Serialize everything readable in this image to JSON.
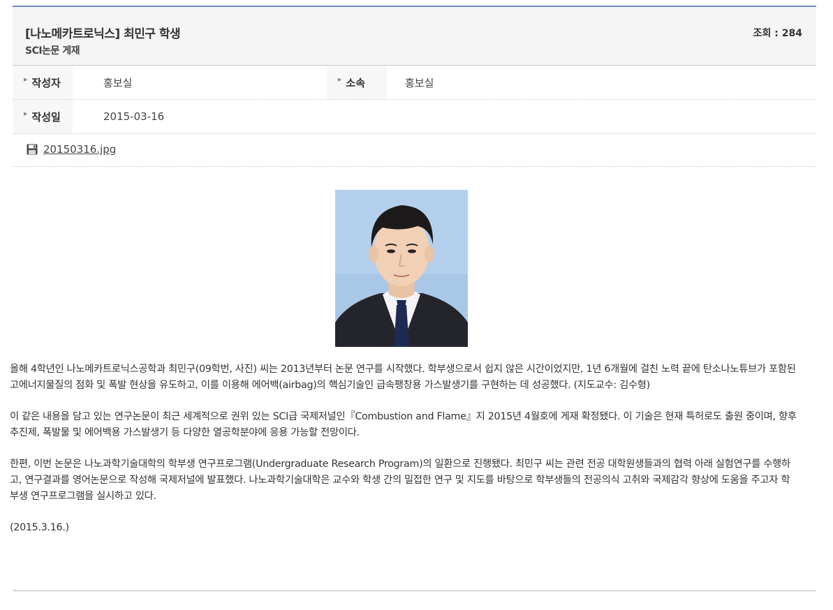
{
  "post": {
    "title": "[나노메카트로닉스] 최민구 학생",
    "subtitle": "SCI논문 게재",
    "views_label": "조회 : 284"
  },
  "meta": {
    "author_label": "작성자",
    "author_value": "홍보실",
    "dept_label": "소속",
    "dept_value": "홍보실",
    "date_label": "작성일",
    "date_value": "2015-03-16"
  },
  "attachment": {
    "icon": "save-disk-icon",
    "filename": "20150316.jpg"
  },
  "photo": {
    "subject": "student-portrait"
  },
  "body": {
    "paragraphs": [
      "올해 4학년인 나노메카트로닉스공학과 최민구(09학번, 사진) 씨는 2013년부터 논문 연구를 시작했다. 학부생으로서 쉽지 않은 시간이었지만, 1년 6개월에 걸친 노력 끝에 탄소나노튜브가 포함된 고에너지물질의 점화 및 폭발 현상을 유도하고, 이를 이용해 에어백(airbag)의 핵심기술인 급속팽창용 가스발생기를 구현하는 데 성공했다. (지도교수: 김수형)",
      "이 같은 내용을 담고 있는 연구논문이 최근 세계적으로 권위 있는 SCI급 국제저널인『Combustion and Flame』지 2015년 4월호에 게재 확정됐다. 이 기술은 현재 특허로도 출원 중이며, 향후 추진제, 폭발물 및 에어백용 가스발생기 등 다양한 열공학분야에 응용 가능할 전망이다.",
      "한편, 이번 논문은 나노과학기술대학의 학부생 연구프로그램(Undergraduate Research Program)의 일환으로 진행됐다. 최민구 씨는 관련 전공 대학원생들과의 협력 아래 실험연구를 수행하고, 연구결과를 영어논문으로 작성해 국제저널에 발표했다. 나노과학기술대학은 교수와 학생 간의 밀접한 연구 및 지도를 바탕으로 학부생들의 전공의식 고취와 국제감각 향상에 도움을 주고자 학부생 연구프로그램을 실시하고 있다.",
      "(2015.3.16.)"
    ]
  },
  "colors": {
    "header_top_border": "#6f8fc2",
    "header_bg": "#f5f5f5",
    "photo_bg": "#a9c8e8"
  }
}
